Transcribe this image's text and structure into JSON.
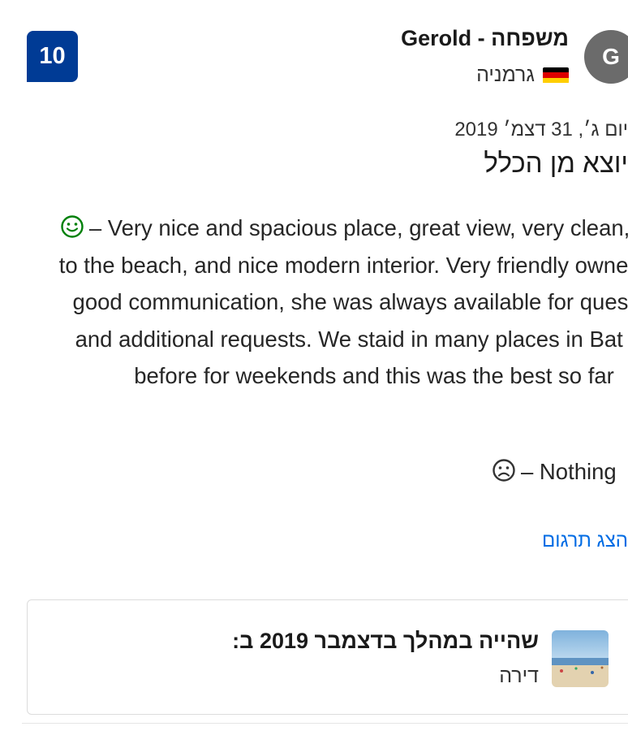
{
  "review": {
    "score": "10",
    "reviewer": {
      "avatar_letter": "G",
      "name": "Gerold - משפחה",
      "country": "גרמניה",
      "flag_colors": [
        "#000000",
        "#dd0000",
        "#ffce00"
      ]
    },
    "date": "יום ג׳, 31 דצמ׳ 2019",
    "title": "יוצא מן הכלל",
    "positive": {
      "icon": "smiley-face-icon",
      "color": "#008009",
      "text": "– Very nice and spacious place, great view, very clean, close to the beach, and nice modern interior. Very friendly owner, very good communication, she was always available for questions and additional requests. We staid in many places in Bat Yam before for weekends and this was the best so far"
    },
    "negative": {
      "icon": "frowning-face-icon",
      "color": "#333333",
      "text": "– Nothing"
    },
    "translate_label": "הצג תרגום"
  },
  "stay": {
    "label": "שהייה במהלך בדצמבר 2019 ב:",
    "room_type": "דירה",
    "thumbnail": "beach-photo"
  },
  "colors": {
    "badge": "#003b95",
    "link": "#006ce4",
    "avatar": "#6b6b6b"
  }
}
